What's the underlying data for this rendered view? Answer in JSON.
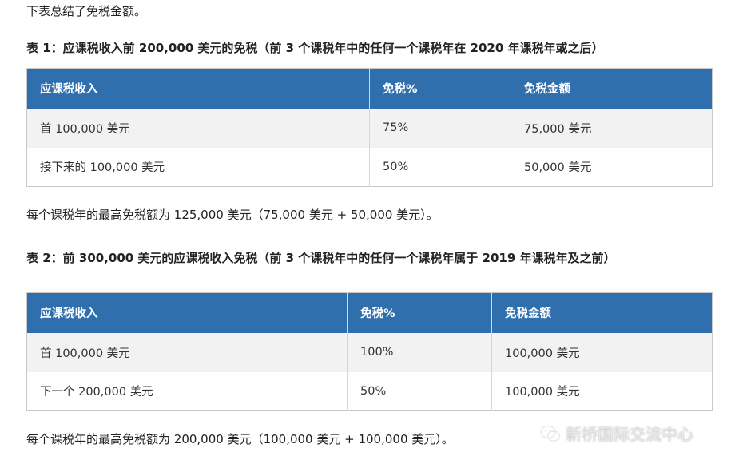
{
  "intro_text": "下表总结了免税金额。",
  "table1": {
    "caption": "表 1：应课税收入前 200,000 美元的免税（前 3 个课税年中的任何一个课税年在 2020 年课税年或之后）",
    "headers": [
      "应课税收入",
      "免税%",
      "免税金额"
    ],
    "rows": [
      [
        "首 100,000 美元",
        "75%",
        "75,000 美元"
      ],
      [
        "接下来的 100,000 美元",
        "50%",
        "50,000 美元"
      ]
    ]
  },
  "note1": "每个课税年的最高免税额为 125,000 美元（75,000 美元 + 50,000 美元）。",
  "table2": {
    "caption": "表 2：前 300,000 美元的应课税收入免税（前 3 个课税年中的任何一个课税年属于 2019 年课税年及之前）",
    "headers": [
      "应课税收入",
      "免税%",
      "免税金额"
    ],
    "rows": [
      [
        "首 100,000 美元",
        "100%",
        "100,000 美元"
      ],
      [
        "下一个 200,000 美元",
        "50%",
        "100,000 美元"
      ]
    ]
  },
  "note2": "每个课税年的最高免税额为 200,000 美元（100,000 美元 + 100,000 美元）。",
  "watermark": {
    "text": "新桥国际交流中心",
    "icon": "wechat-icon"
  }
}
